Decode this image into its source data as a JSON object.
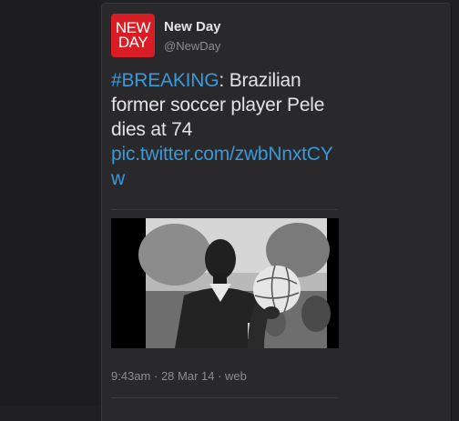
{
  "account": {
    "logo_line1": "NEW",
    "logo_line2": "DAY",
    "display_name": "New Day",
    "handle": "@NewDay"
  },
  "tweet": {
    "hashtag": "#BREAKING",
    "body": ": Brazilian former soccer player Pele dies at 74",
    "pic_link": "pic.twitter.com/zwbNnxtCYw",
    "time": "9:43am",
    "separator": " · ",
    "date": "28 Mar 14",
    "source": "web"
  },
  "colors": {
    "background": "#202022",
    "card": "#29292c",
    "brand_red": "#d81e24",
    "link_blue": "#3a99d8"
  }
}
